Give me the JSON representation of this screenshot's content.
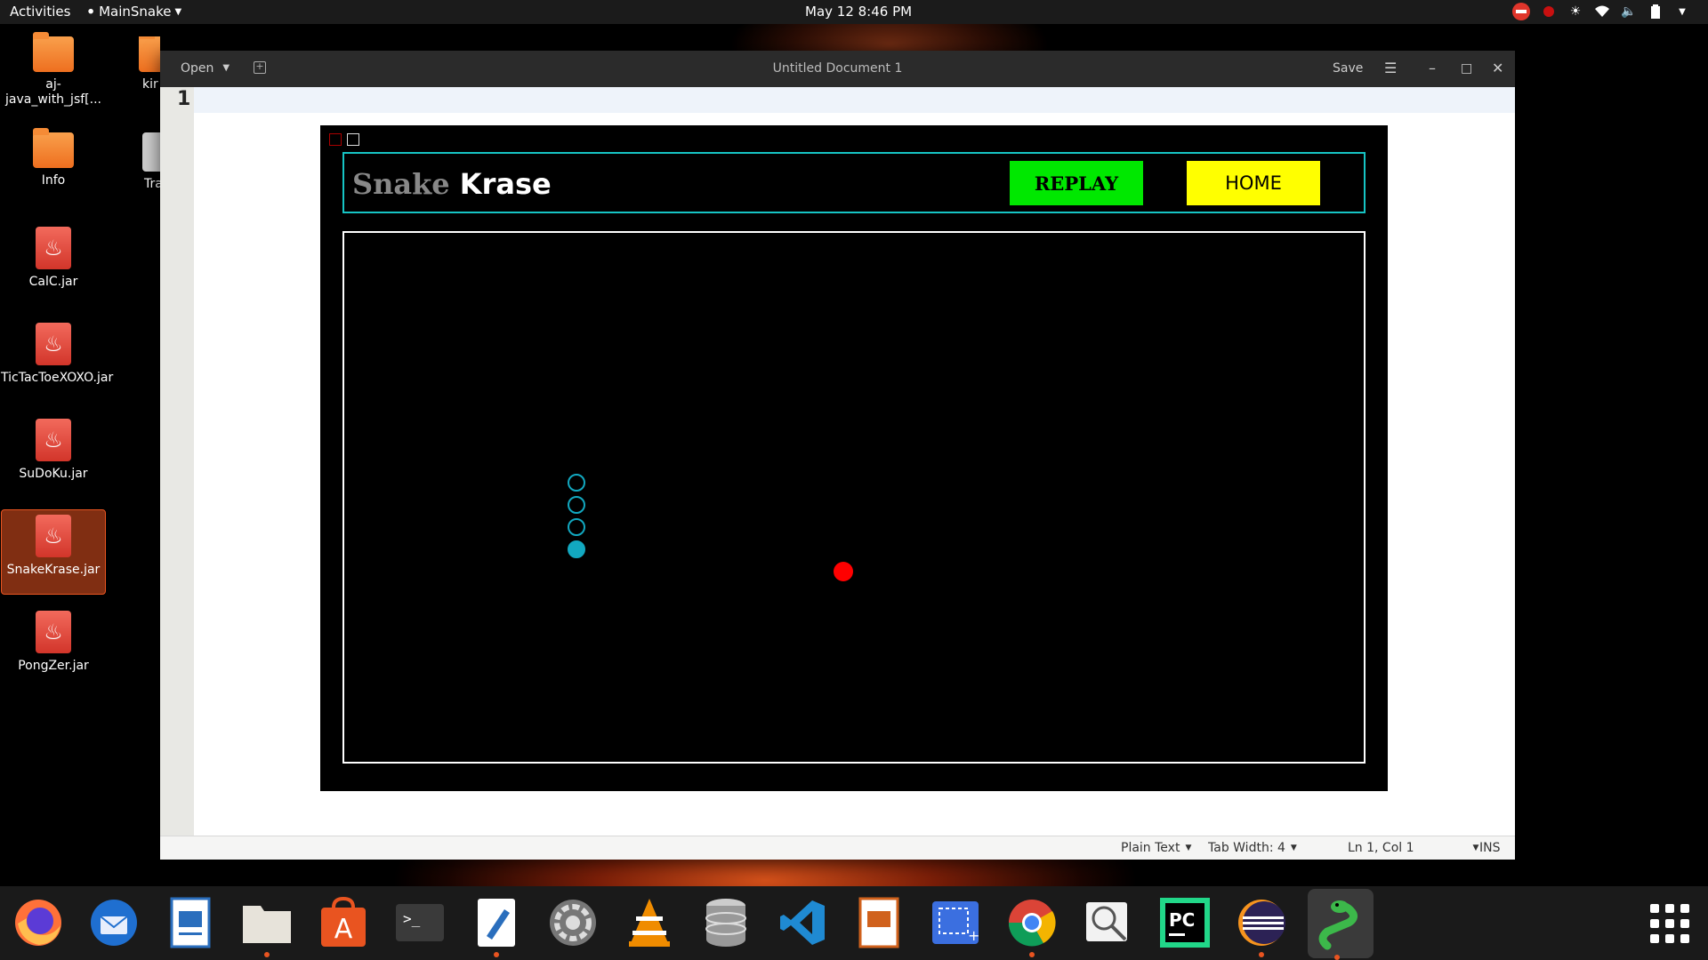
{
  "topbar": {
    "activities": "Activities",
    "app_menu": "MainSnake",
    "clock": "May 12  8:46 PM"
  },
  "desktop": {
    "icons": [
      {
        "label": "aj-java_with_jsf[...",
        "type": "folder"
      },
      {
        "label": "kir",
        "type": "folder"
      },
      {
        "label": "Info",
        "type": "folder"
      },
      {
        "label": "Tra",
        "type": "trash"
      },
      {
        "label": "CalC.jar",
        "type": "jar"
      },
      {
        "label": "TicTacToeXOXO.jar",
        "type": "jar"
      },
      {
        "label": "SuDoKu.jar",
        "type": "jar"
      },
      {
        "label": "SnakeKrase.jar",
        "type": "jar"
      },
      {
        "label": "PongZer.jar",
        "type": "jar"
      }
    ]
  },
  "editor": {
    "open_label": "Open",
    "title": "Untitled Document 1",
    "save_label": "Save",
    "line_number": "1",
    "status": {
      "language": "Plain Text",
      "tab_width": "Tab Width: 4",
      "position": "Ln 1, Col 1",
      "mode": "INS"
    }
  },
  "game": {
    "title_part1": "Snake",
    "title_part2": "Krase",
    "replay_label": "REPLAY",
    "home_label": "HOME",
    "colors": {
      "header_border": "#16c4c4",
      "replay_bg": "#00e800",
      "home_bg": "#ffff00",
      "snake": "#12a8c0",
      "food": "#ff0000"
    }
  },
  "dock": {
    "apps": [
      "firefox-icon",
      "thunderbird-icon",
      "libreoffice-writer-icon",
      "files-icon",
      "app-center-icon",
      "terminal-icon",
      "text-editor-icon",
      "settings-icon",
      "vlc-icon",
      "database-icon",
      "vscode-icon",
      "impress-icon",
      "screenshot-icon",
      "chrome-icon",
      "image-viewer-icon",
      "pycharm-icon",
      "eclipse-icon",
      "snake-app-icon"
    ]
  }
}
